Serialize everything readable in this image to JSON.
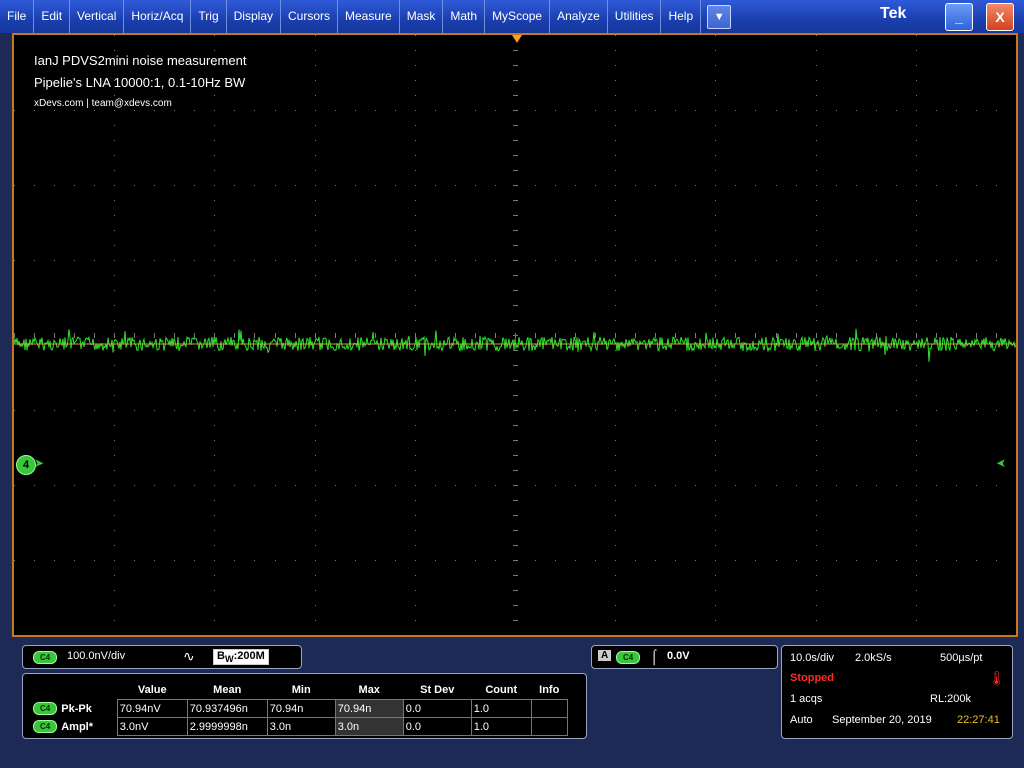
{
  "menu": {
    "items": [
      "File",
      "Edit",
      "Vertical",
      "Horiz/Acq",
      "Trig",
      "Display",
      "Cursors",
      "Measure",
      "Mask",
      "Math",
      "MyScope",
      "Analyze",
      "Utilities",
      "Help"
    ],
    "brand": "Tek",
    "minimize_label": "_",
    "close_label": "X"
  },
  "screen": {
    "annotation_title": "IanJ PDVS2mini noise measurement",
    "annotation_subtitle": "Pipelie's LNA 10000:1, 0.1-10Hz BW",
    "annotation_contact": "xDevs.com | team@xdevs.com",
    "channel_marker": "4"
  },
  "channel_panel": {
    "channel": "C4",
    "scale": "100.0nV/div",
    "bw_label": "B",
    "bw_sub": "W",
    "bw_value": ":200M"
  },
  "trigger_panel": {
    "mode": "A",
    "channel": "C4",
    "level": "0.0V"
  },
  "measurements": {
    "headers": [
      "Value",
      "Mean",
      "Min",
      "Max",
      "St Dev",
      "Count",
      "Info"
    ],
    "rows": [
      {
        "channel": "C4",
        "name": "Pk-Pk",
        "cells": [
          "70.94nV",
          "70.937496n",
          "70.94n",
          "70.94n",
          "0.0",
          "1.0",
          ""
        ]
      },
      {
        "channel": "C4",
        "name": "Ampl*",
        "cells": [
          "3.0nV",
          "2.9999998n",
          "3.0n",
          "3.0n",
          "0.0",
          "1.0",
          ""
        ]
      }
    ]
  },
  "acquisition": {
    "timebase": "10.0s/div",
    "sample_rate": "2.0kS/s",
    "resolution": "500µs/pt",
    "state": "Stopped",
    "acqs": "1 acqs",
    "record_length": "RL:200k",
    "trigger_mode": "Auto",
    "date": "September 20, 2019",
    "time": "22:27:41"
  },
  "colors": {
    "trace": "#2ee62e",
    "accent": "#f4a020",
    "stopped": "#ff2a2a",
    "time": "#f0c020"
  }
}
